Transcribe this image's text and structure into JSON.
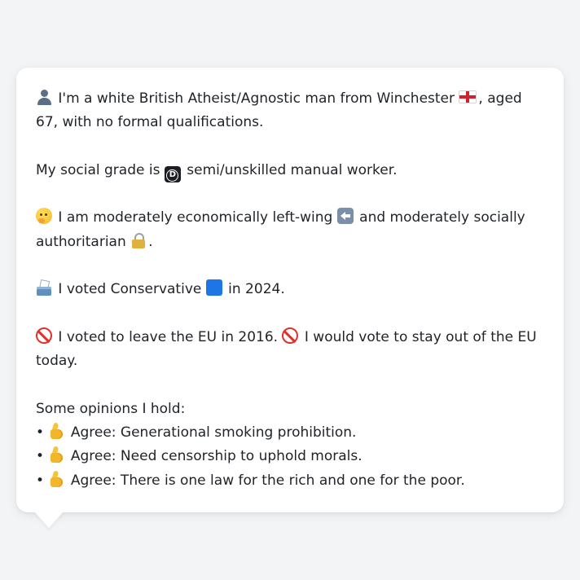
{
  "profile": {
    "intro": {
      "icon": "bust-in-silhouette-icon",
      "text_a": "I'm a white British Atheist/Agnostic man from Winchester",
      "flag_icon": "england-flag-icon",
      "text_b": ", aged 67, with no formal qualifications."
    },
    "social_grade": {
      "text_a": "My social grade is",
      "grade_icon": "letter-d-square-icon",
      "text_b": "semi/unskilled manual worker."
    },
    "politics": {
      "icon_a": "thinking-face-icon",
      "text_a": "I am moderately economically left-wing",
      "icon_b": "left-arrow-icon",
      "text_b": "and moderately socially authoritarian",
      "icon_c": "lock-icon",
      "text_c": "."
    },
    "vote_2024": {
      "icon_a": "ballot-box-icon",
      "text_a": "I voted Conservative",
      "icon_b": "blue-square-icon",
      "text_b": "in 2024."
    },
    "eu": {
      "icon_a": "prohibited-icon",
      "text_a": "I voted to leave the EU in 2016.",
      "icon_b": "prohibited-icon",
      "text_b": "I would vote to stay out of the EU today."
    },
    "opinions": {
      "heading": "Some opinions I hold:",
      "bullet": "•",
      "items": [
        {
          "icon": "thumbs-up-icon",
          "text": "Agree: Generational smoking prohibition."
        },
        {
          "icon": "thumbs-up-icon",
          "text": "Agree: Need censorship to uphold morals."
        },
        {
          "icon": "thumbs-up-icon",
          "text": "Agree: There is one law for the rich and one for the poor."
        }
      ]
    }
  },
  "colors": {
    "page_background": "#f3f4f6",
    "card_background": "#ffffff",
    "text": "#1f2328",
    "conservative_blue": "#1d75e6",
    "prohibited_red": "#e0312b"
  }
}
